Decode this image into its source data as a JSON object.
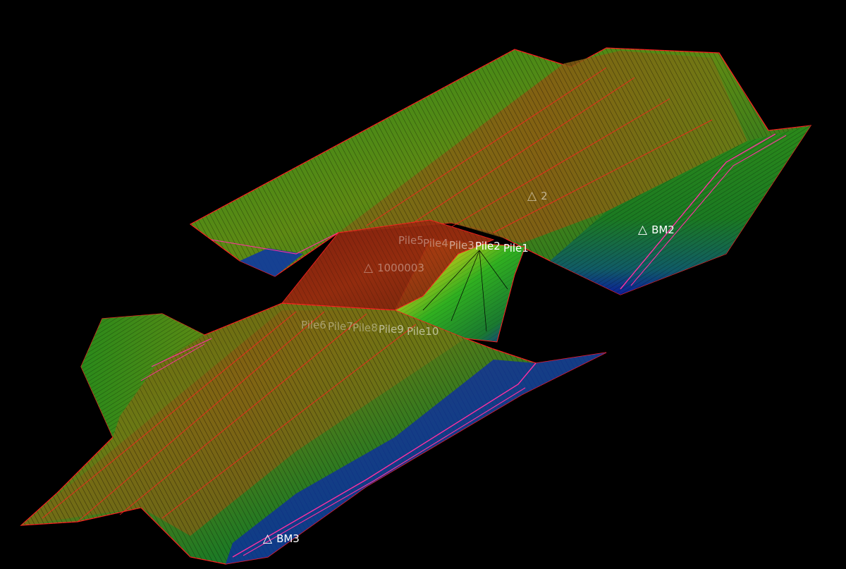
{
  "scene": {
    "background": "#000000",
    "mesh_edge_color": "#000000",
    "boundary_color": "#ff2020",
    "gradient_colors": [
      "#1a8c1a",
      "#6e8a10",
      "#b04010",
      "#0a1aa0"
    ]
  },
  "markers": {
    "bm2": {
      "icon": "triangle-icon",
      "label": "BM2"
    },
    "bm3": {
      "icon": "triangle-icon",
      "label": "BM3"
    },
    "pt2": {
      "icon": "triangle-icon",
      "label": "2"
    },
    "pt_mid": {
      "icon": "triangle-icon",
      "label": "1000003"
    }
  },
  "piles": {
    "upper": [
      "Pile5",
      "Pile4",
      "Pile3",
      "Pile2",
      "Pile1"
    ],
    "lower": [
      "Pile6",
      "Pile7",
      "Pile8",
      "Pile9",
      "Pile10"
    ]
  }
}
